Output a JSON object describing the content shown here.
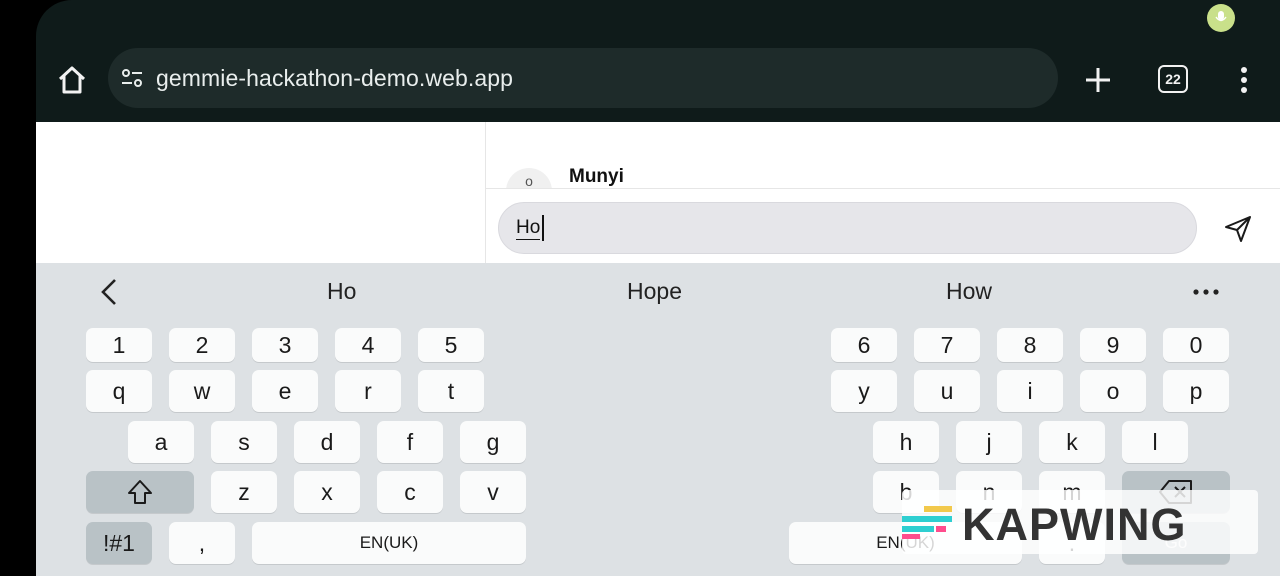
{
  "status": {
    "mic_indicator_color": "#c9e08a"
  },
  "toolbar": {
    "url": "gemmie-hackathon-demo.web.app",
    "tab_count": "22",
    "icons": [
      "home-icon",
      "tune-icon",
      "plus-icon",
      "tabs-icon",
      "more-vert-icon"
    ]
  },
  "page": {
    "chat_item": {
      "avatar_initial": "o",
      "name": "Munyi"
    },
    "message_input": {
      "value": "Ho"
    }
  },
  "keyboard": {
    "suggestions": [
      "Ho",
      "Hope",
      "How"
    ],
    "number_row_left": [
      "1",
      "2",
      "3",
      "4",
      "5"
    ],
    "number_row_right": [
      "6",
      "7",
      "8",
      "9",
      "0"
    ],
    "row1_left": [
      "q",
      "w",
      "e",
      "r",
      "t"
    ],
    "row1_right": [
      "y",
      "u",
      "i",
      "o",
      "p"
    ],
    "row2_left": [
      "a",
      "s",
      "d",
      "f",
      "g"
    ],
    "row2_right": [
      "h",
      "j",
      "k",
      "l"
    ],
    "row3_left": [
      "z",
      "x",
      "c",
      "v"
    ],
    "row3_right": [
      "b",
      "n",
      "m"
    ],
    "symbols_label": "!#1",
    "comma_label": ",",
    "space_left_label": "EN(UK)",
    "space_right_label": "EN(UK)",
    "period_label": ".",
    "go_label": "Go",
    "colors": {
      "background": "#dde1e4",
      "key": "#fafbfb",
      "function_key": "#b9c2c6"
    }
  },
  "watermark": {
    "text": "KAPWING",
    "colors": [
      "#2ecfd1",
      "#f2c94c",
      "#ff4d8d"
    ]
  }
}
